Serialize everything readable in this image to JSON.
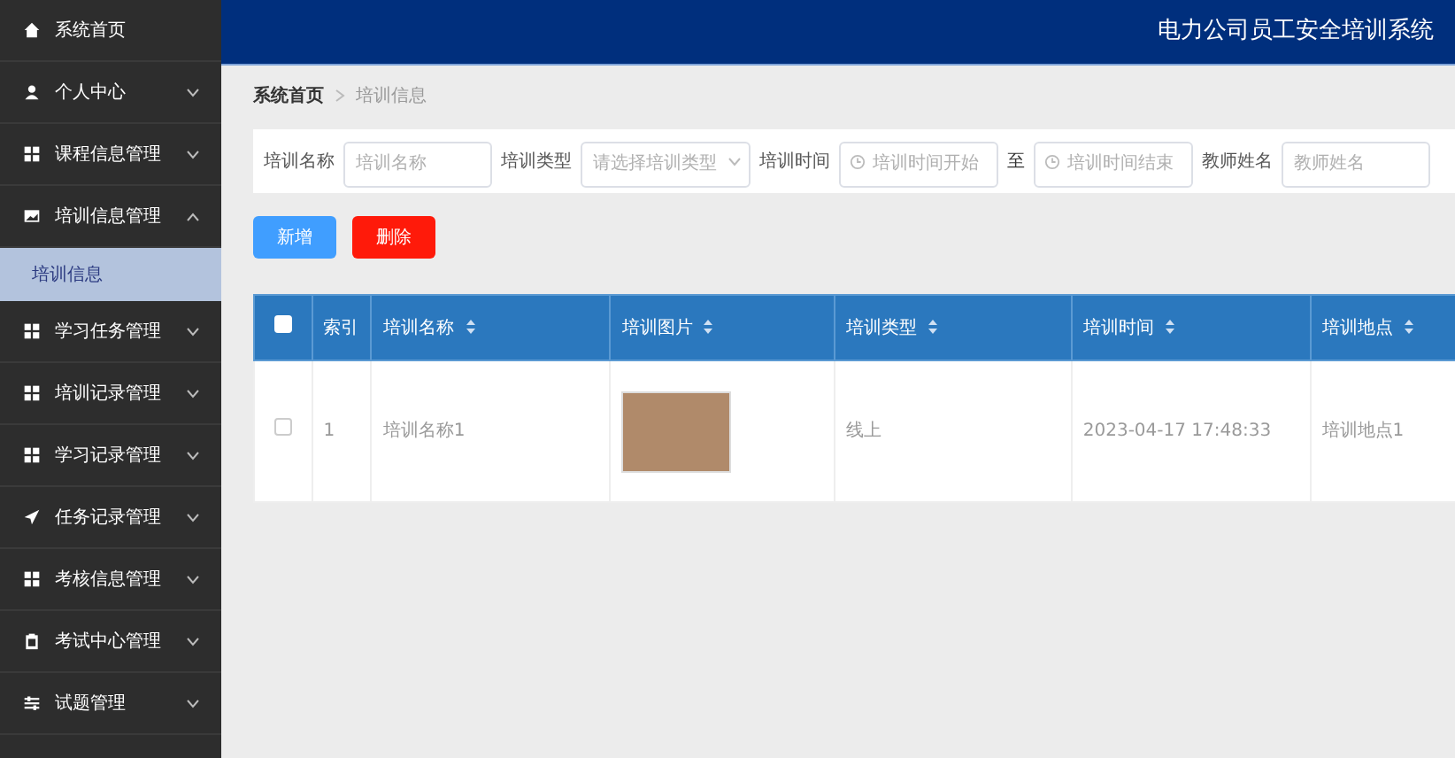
{
  "header": {
    "title": "电力公司员工安全培训系统"
  },
  "sidebar": {
    "items": [
      {
        "label": "系统首页",
        "kind": "home"
      },
      {
        "label": "个人中心",
        "kind": "user",
        "expanded": false
      },
      {
        "label": "课程信息管理",
        "kind": "grid",
        "expanded": false
      },
      {
        "label": "培训信息管理",
        "kind": "picture",
        "expanded": true,
        "children": [
          {
            "label": "培训信息",
            "selected": true
          }
        ]
      },
      {
        "label": "学习任务管理",
        "kind": "grid",
        "expanded": false
      },
      {
        "label": "培训记录管理",
        "kind": "grid",
        "expanded": false
      },
      {
        "label": "学习记录管理",
        "kind": "grid",
        "expanded": false
      },
      {
        "label": "任务记录管理",
        "kind": "send",
        "expanded": false
      },
      {
        "label": "考核信息管理",
        "kind": "grid",
        "expanded": false
      },
      {
        "label": "考试中心管理",
        "kind": "clipboard",
        "expanded": false
      },
      {
        "label": "试题管理",
        "kind": "sliders",
        "expanded": false
      }
    ]
  },
  "breadcrumb": [
    "系统首页",
    "培训信息"
  ],
  "filters": [
    {
      "kind": "text",
      "label": "培训名称",
      "placeholder": "培训名称"
    },
    {
      "kind": "select",
      "label": "培训类型",
      "placeholder": "请选择培训类型"
    },
    {
      "kind": "daterange",
      "label": "培训时间",
      "placeholder": "培训时间开始",
      "separator": "至",
      "placeholder_end": "培训时间结束"
    },
    {
      "kind": "text",
      "label": "教师姓名",
      "placeholder": "教师姓名"
    }
  ],
  "buttons": [
    {
      "label": "新增",
      "kind": "primary"
    },
    {
      "label": "删除",
      "kind": "danger"
    }
  ],
  "table": {
    "header_checked": false,
    "columns": [
      {
        "label": "索引",
        "sortable": false
      },
      {
        "label": "培训名称",
        "sortable": true
      },
      {
        "label": "培训图片",
        "sortable": true
      },
      {
        "label": "培训类型",
        "sortable": true
      },
      {
        "label": "培训时间",
        "sortable": true
      },
      {
        "label": "培训地点",
        "sortable": true
      }
    ],
    "rows": [
      {
        "checked": false,
        "cells": [
          {
            "kind": "text",
            "text": "1"
          },
          {
            "kind": "text",
            "text": "培训名称1"
          },
          {
            "kind": "image"
          },
          {
            "kind": "text",
            "text": "线上"
          },
          {
            "kind": "text",
            "text": "2023-04-17 17:48:33"
          },
          {
            "kind": "text",
            "text": "培训地点1"
          }
        ]
      }
    ]
  }
}
